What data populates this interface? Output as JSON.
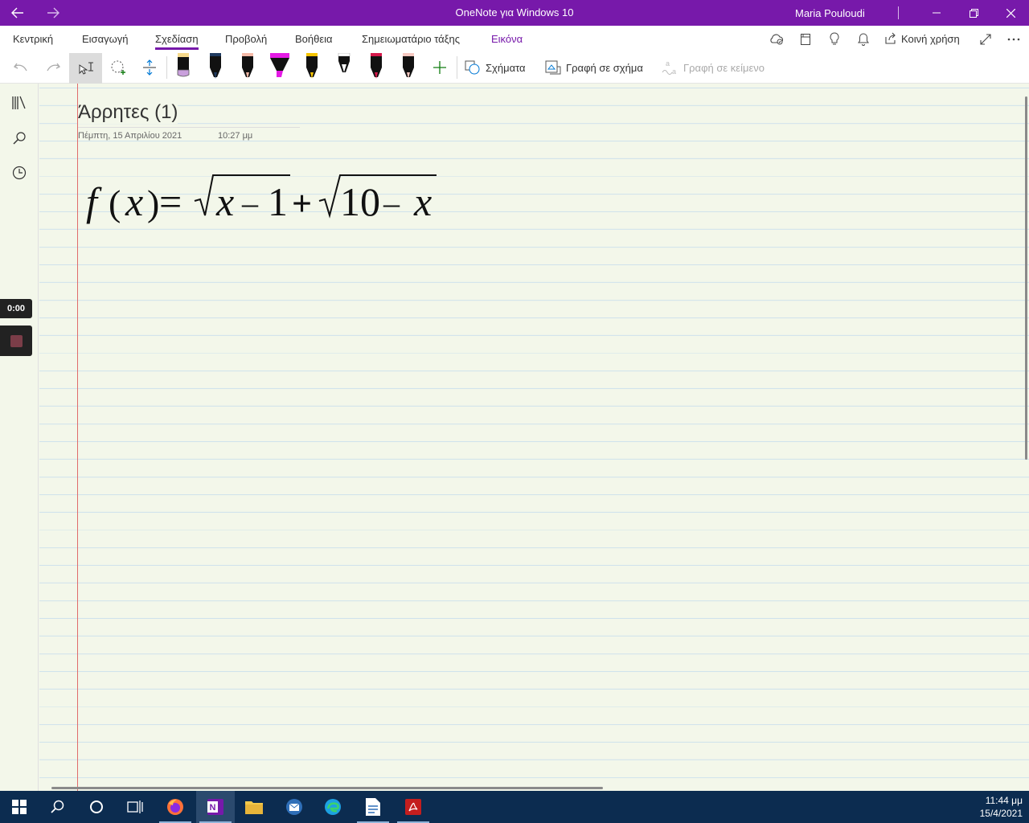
{
  "window": {
    "title": "OneNote για Windows 10",
    "user": "Maria Pouloudi"
  },
  "ribbon": {
    "tabs": [
      "Κεντρική",
      "Εισαγωγή",
      "Σχεδίαση",
      "Προβολή",
      "Βοήθεια",
      "Σημειωματάριο τάξης",
      "Εικόνα"
    ],
    "active_tab": "Σχεδίαση",
    "share_label": "Κοινή χρήση",
    "shapes_label": "Σχήματα",
    "ink_to_shape_label": "Γραφή σε σχήμα",
    "ink_to_text_label": "Γραφή σε κείμενο",
    "pens": [
      {
        "name": "pencil-black",
        "color": "#111111",
        "accent": "#c9a0dc"
      },
      {
        "name": "pen-dark-blue",
        "color": "#1f3a5f",
        "accent": "#1f3a5f"
      },
      {
        "name": "pen-peach",
        "color": "#111111",
        "accent": "#f4b9a8"
      },
      {
        "name": "highlighter-magenta",
        "color": "#111111",
        "accent": "#e51ae5"
      },
      {
        "name": "pen-yellow",
        "color": "#111111",
        "accent": "#f5c400"
      },
      {
        "name": "pen-white",
        "color": "#111111",
        "accent": "#ffffff"
      },
      {
        "name": "pen-crimson",
        "color": "#111111",
        "accent": "#d6194b"
      },
      {
        "name": "pen-light-pink",
        "color": "#111111",
        "accent": "#f6c8c0"
      }
    ]
  },
  "page": {
    "title": "Άρρητες (1)",
    "date": "Πέμπτη, 15 Απριλίου 2021",
    "time": "10:27 μμ",
    "formula": {
      "f": "f",
      "lparen": "(",
      "x1": "x",
      "rparen": ")",
      "eq": "=",
      "sqrt1_radicand_var": "x",
      "sqrt1_minus": "–",
      "sqrt1_const": "1",
      "plus": "+",
      "sqrt2_const": "10",
      "sqrt2_minus": "–",
      "sqrt2_var": "x"
    }
  },
  "recorder": {
    "time": "0:00"
  },
  "taskbar": {
    "clock_time": "11:44 μμ",
    "clock_date": "15/4/2021"
  }
}
